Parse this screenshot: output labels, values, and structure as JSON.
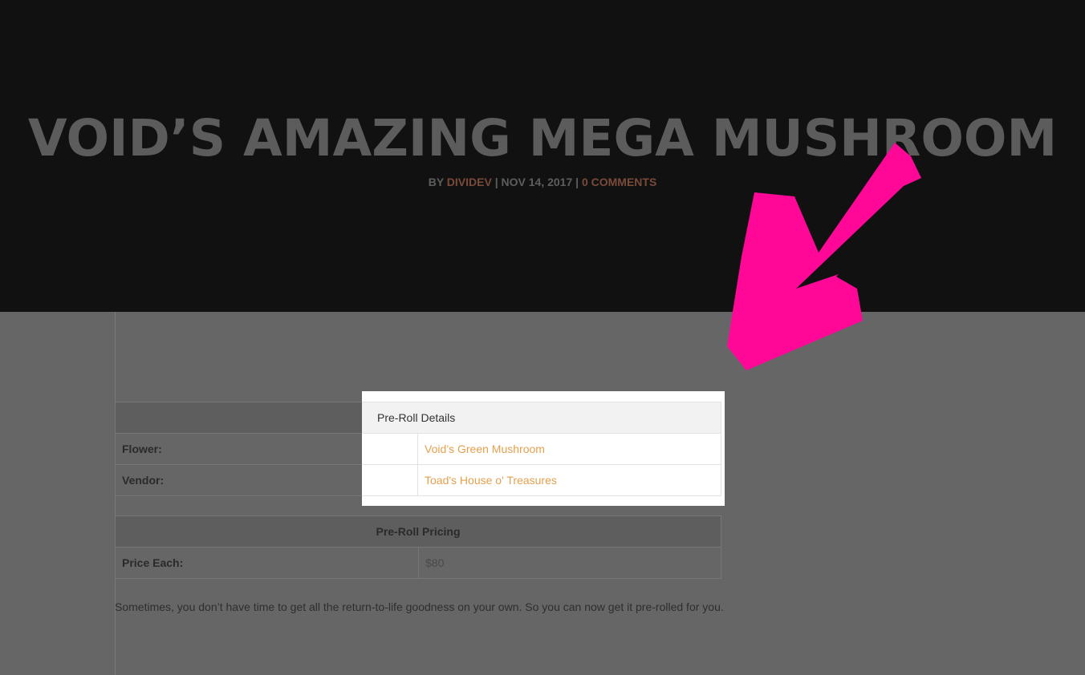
{
  "post": {
    "title": "VOID’S AMAZING MEGA MUSHROOM",
    "meta_by": "BY",
    "author": "DIVIDEV",
    "separator": "|",
    "date": "NOV 14, 2017",
    "comments": "0 COMMENTS"
  },
  "details_table": {
    "header": "Pre-Roll Details",
    "rows": [
      {
        "label": "Flower:",
        "value": "Void’s Green Mushroom"
      },
      {
        "label": "Vendor:",
        "value": "Toad's House o' Treasures"
      }
    ]
  },
  "pricing_table": {
    "header": "Pre-Roll Pricing",
    "rows": [
      {
        "label": "Price Each:",
        "value": "$80"
      }
    ]
  },
  "excerpt": "Sometimes, you don’t have time to get all the return-to-life goodness on your own. So you can now get it pre-rolled for you.",
  "annotation": {
    "arrow_color": "#ff0898"
  }
}
